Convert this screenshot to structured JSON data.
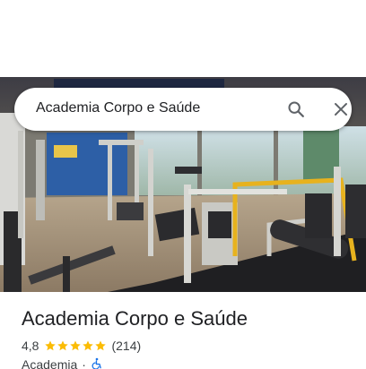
{
  "search": {
    "query": "Academia Corpo e Saúde",
    "search_icon": "search-icon",
    "close_icon": "close-icon"
  },
  "photo": {
    "subject": "gym-interior-photo"
  },
  "place": {
    "title": "Academia Corpo e Saúde",
    "rating": "4,8",
    "stars": 5,
    "review_count": "(214)",
    "category": "Academia",
    "separator": "·",
    "accessibility_icon": "wheelchair-icon",
    "colors": {
      "star": "#fbbc04",
      "accessibility": "#1a73e8",
      "text_primary": "#202124",
      "text_secondary": "#3c4043"
    }
  }
}
